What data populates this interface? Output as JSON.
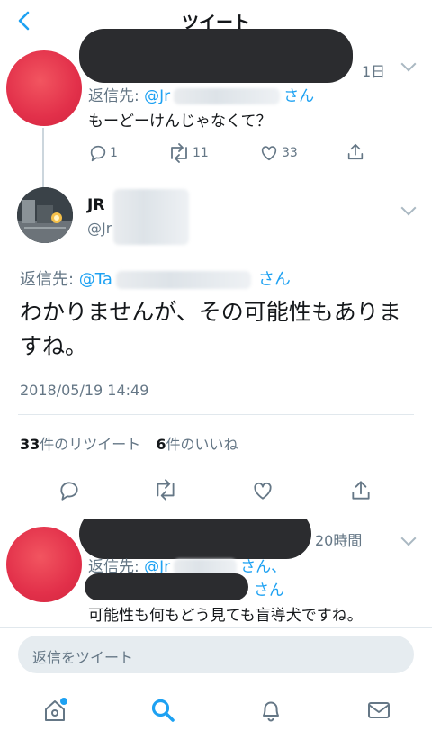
{
  "header": {
    "title": "ツイート"
  },
  "tweet1": {
    "time": "1日",
    "reply_prefix": "返信先: ",
    "reply_handle": "@Jr",
    "reply_suffix": "さん",
    "text": "もーどーけんじゃなくて？",
    "actions": {
      "reply_count": "1",
      "retweet_count": "11",
      "like_count": "33"
    }
  },
  "main": {
    "name": "JR",
    "handle": "@Jr",
    "reply_prefix": "返信先: ",
    "reply_handle": "@Ta",
    "reply_suffix": "さん",
    "text": "わかりませんが、その可能性もありますね。",
    "timestamp": "2018/05/19 14:49",
    "retweets_count": "33",
    "retweets_label": "件のリツイート",
    "likes_count": "6",
    "likes_label": "件のいいね"
  },
  "tweet3": {
    "time": "20時間",
    "reply_prefix": "返信先: ",
    "reply_handle": "@Jr",
    "reply_suffix1": "さん、",
    "reply_suffix2": "さん",
    "text": "可能性も何もどう見ても盲導犬ですね。"
  },
  "composer": {
    "placeholder": "返信をツイート"
  },
  "bottom_nav": {
    "items": [
      "home-icon",
      "search-icon",
      "notifications-icon",
      "messages-icon"
    ],
    "active": "search-icon"
  },
  "colors": {
    "accent": "#1da1f2",
    "text": "#14171a",
    "secondary": "#657786",
    "avatar_red": "#e2304a"
  }
}
